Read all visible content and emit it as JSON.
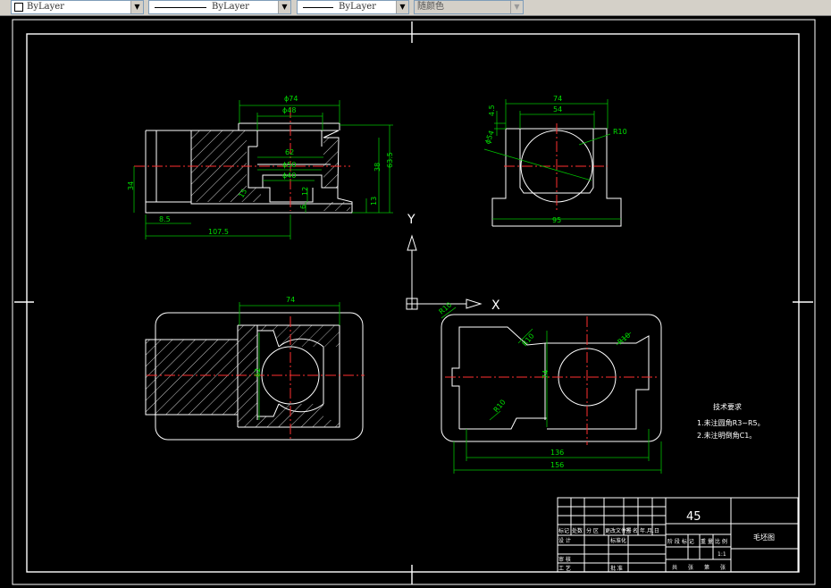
{
  "toolbar": {
    "layer_combo": "ByLayer",
    "linetype_combo": "ByLayer",
    "lineweight_combo": "ByLayer",
    "color_combo": "随颜色"
  },
  "drawing": {
    "dims": {
      "d74_top": "ϕ74",
      "d48": "ϕ48",
      "d62": "62",
      "d50": "ϕ50",
      "d40": "ϕ40",
      "d34": "34",
      "d85": "8.5",
      "d1075": "107.5",
      "d38": "38",
      "d635": "63.5",
      "d13": "13",
      "d12": "12",
      "d6": "6",
      "d15": "15",
      "side_74": "74",
      "side_54": "54",
      "side_45": "4.5",
      "side_r10": "R10",
      "side_phi54": "ϕ54",
      "side_95": "95",
      "plan_74": "74",
      "plan_62": "62",
      "right_r10a": "R10",
      "right_r10b": "R10",
      "right_r10c": "R10",
      "right_r10d": "R10",
      "right_74": "74",
      "right_136": "136",
      "right_156": "156"
    },
    "ucs": {
      "y_label": "Y",
      "x_label": "X"
    },
    "notes": {
      "title": "技术要求",
      "line1": "1.未注圆角R3~R5。",
      "line2": "2.未注明倒角C1。"
    },
    "title_block": {
      "material": "45",
      "drawing_name": "毛坯图",
      "scale": "1:1",
      "row_labels": [
        "标记",
        "处数",
        "分 区",
        "更改文件号",
        "签 名",
        "年.月.日"
      ],
      "design": "设 计",
      "standardize": "标准化",
      "review": "审 核",
      "process": "工 艺",
      "approve": "批 准",
      "stage_labels": [
        "阶 段 标 记",
        "重 量",
        "比 例"
      ],
      "sheets": [
        "共",
        "张",
        "第",
        "张"
      ]
    }
  }
}
